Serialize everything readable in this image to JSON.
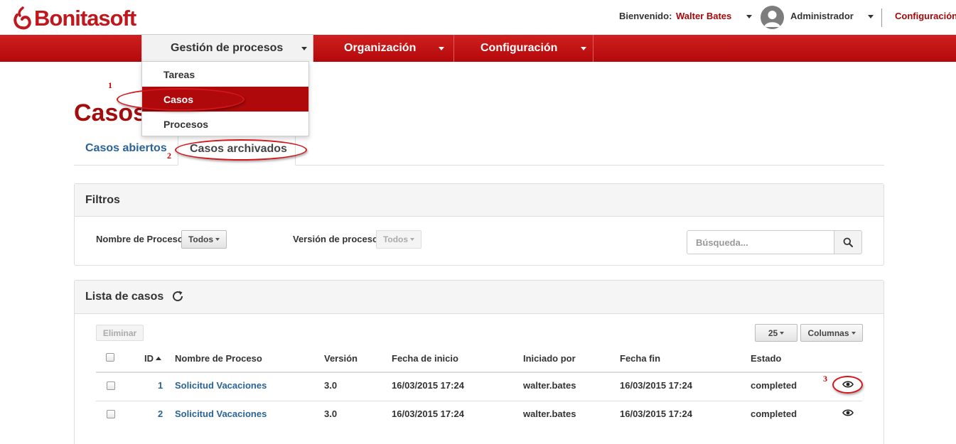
{
  "header": {
    "logo": "Bonitasoft",
    "welcome_label": "Bienvenido:",
    "user_name": "Walter Bates",
    "role": "Administrador",
    "config_link": "Configuración"
  },
  "nav": {
    "items": [
      {
        "label": "Gestión de procesos"
      },
      {
        "label": "Organización"
      },
      {
        "label": "Configuración"
      }
    ],
    "dropdown": [
      {
        "label": "Tareas"
      },
      {
        "label": "Casos"
      },
      {
        "label": "Procesos"
      }
    ]
  },
  "page": {
    "title": "Casos",
    "tabs": [
      {
        "label": "Casos abiertos"
      },
      {
        "label": "Casos archivados"
      }
    ]
  },
  "filters": {
    "title": "Filtros",
    "process_name_label": "Nombre de Proceso",
    "process_name_value": "Todos",
    "version_label": "Versión de proceso",
    "version_value": "Todos",
    "search_placeholder": "Búsqueda..."
  },
  "list": {
    "title": "Lista de casos",
    "delete_label": "Eliminar",
    "page_size": "25",
    "columns_label": "Columnas",
    "headers": [
      "ID",
      "Nombre de Proceso",
      "Versión",
      "Fecha de inicio",
      "Iniciado por",
      "Fecha fin",
      "Estado"
    ],
    "rows": [
      {
        "id": "1",
        "process": "Solicitud Vacaciones",
        "version": "3.0",
        "start": "16/03/2015 17:24",
        "started_by": "walter.bates",
        "end": "16/03/2015 17:24",
        "state": "completed"
      },
      {
        "id": "2",
        "process": "Solicitud Vacaciones",
        "version": "3.0",
        "start": "16/03/2015 17:24",
        "started_by": "walter.bates",
        "end": "16/03/2015 17:24",
        "state": "completed"
      }
    ]
  },
  "annotations": [
    "1",
    "2",
    "3"
  ],
  "colors": {
    "brand_red": "#c0171c",
    "nav_red": "#b3080b",
    "link_blue": "#2a6496"
  }
}
